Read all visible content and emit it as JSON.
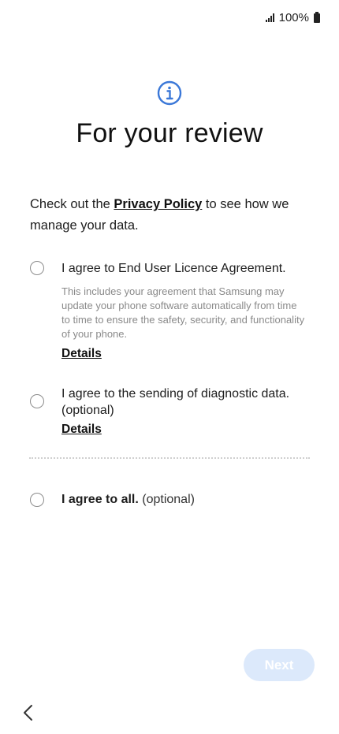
{
  "status_bar": {
    "battery_text": "100%"
  },
  "header": {
    "title": "For your review",
    "icon": "info-icon"
  },
  "intro": {
    "before": "Check out the ",
    "privacy_link": "Privacy Policy",
    "after": " to see how we manage your data."
  },
  "options": [
    {
      "label": "I agree to End User Licence Agreement.",
      "description": "This includes your agreement that Samsung may update your phone software automatically from time to time to ensure the safety, security, and functionality of your phone.",
      "details_label": "Details",
      "checked": false
    },
    {
      "label": "I agree to the sending of diagnostic data. (optional)",
      "details_label": "Details",
      "checked": false
    }
  ],
  "agree_all": {
    "bold": "I agree to all.",
    "suffix": " (optional)",
    "checked": false
  },
  "footer": {
    "next_label": "Next",
    "next_enabled": false,
    "back_icon": "chevron-left-icon"
  },
  "colors": {
    "accent": "#3b78d8",
    "next_disabled_bg": "#dce9fb"
  }
}
